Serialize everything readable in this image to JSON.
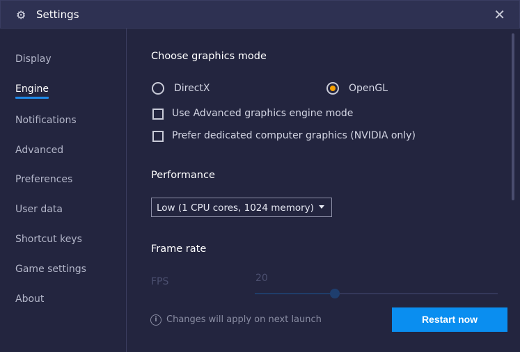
{
  "window": {
    "title": "Settings",
    "icon": "gear-icon",
    "close_icon": "close-icon"
  },
  "sidebar": {
    "items": [
      {
        "label": "Display"
      },
      {
        "label": "Engine",
        "active": true
      },
      {
        "label": "Notifications"
      },
      {
        "label": "Advanced"
      },
      {
        "label": "Preferences"
      },
      {
        "label": "User data"
      },
      {
        "label": "Shortcut keys"
      },
      {
        "label": "Game settings"
      },
      {
        "label": "About"
      }
    ]
  },
  "graphics": {
    "heading": "Choose graphics mode",
    "options": [
      {
        "label": "DirectX",
        "selected": false
      },
      {
        "label": "OpenGL",
        "selected": true
      }
    ],
    "checkboxes": [
      {
        "label": "Use Advanced graphics engine mode",
        "checked": false
      },
      {
        "label": "Prefer dedicated computer graphics (NVIDIA only)",
        "checked": false
      }
    ]
  },
  "performance": {
    "heading": "Performance",
    "selected": "Low (1 CPU cores, 1024 memory)"
  },
  "frame_rate": {
    "heading": "Frame rate",
    "label": "FPS",
    "value": "20",
    "fraction": 0.33
  },
  "footer": {
    "note": "Changes will apply on next launch",
    "restart_label": "Restart now"
  },
  "colors": {
    "accent": "#0a8ef0",
    "radio_selected": "#f5a000",
    "background": "#23253f",
    "titlebar": "#2e3152"
  }
}
